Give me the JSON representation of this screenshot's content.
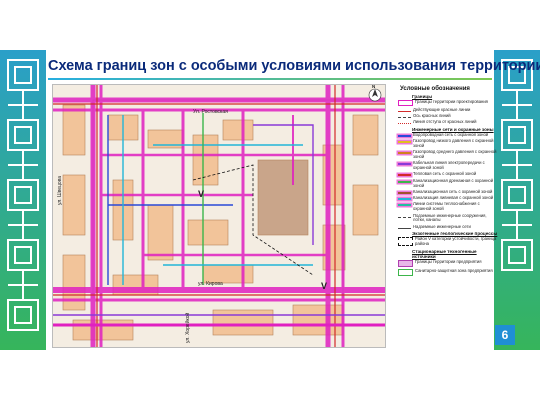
{
  "slide": {
    "title": "Схема границ зон с особыми условиями использования территории",
    "page_number": "6"
  },
  "colors": {
    "border_green": "#2bb673",
    "border_teal": "#1fa0c8",
    "title_blue": "#0a2a7a",
    "page_badge": "#1f8fd4",
    "zone_magenta": "#e020c0",
    "zone_red": "#d22a2a",
    "building": "#f2c49a"
  },
  "map": {
    "streets": {
      "top": "Ул. Ростовская",
      "left": "ул. Швецова",
      "bottom": "ул. Кирова",
      "bottom_left": "ул. Хорейкой"
    },
    "zone_markers": [
      "V",
      "V"
    ],
    "north_arrow_label": "N"
  },
  "legend": {
    "title": "Условные обозначения",
    "sections": [
      {
        "heading": "Границы",
        "items": [
          {
            "symbol": "boundary",
            "text": "Границы территории проектирования"
          },
          {
            "symbol": "red-line",
            "text": "Действующие красные линии"
          },
          {
            "symbol": "dash-line",
            "text": "Ось красных линий"
          },
          {
            "symbol": "thin-line",
            "text": "Линия отступа от красных линий"
          }
        ]
      },
      {
        "heading": "Инженерные сети и охранные зоны",
        "items": [
          {
            "symbol": "water",
            "text": "Водопроводная сеть с охранной зоной"
          },
          {
            "symbol": "gas-low",
            "text": "Газопровод низкого давления с охранной зоной"
          },
          {
            "symbol": "gas-mid",
            "text": "Газопровод среднего давления с охранной зоной"
          },
          {
            "symbol": "cable",
            "text": "Кабельная линия электропередачи с охранной зоной"
          },
          {
            "symbol": "heat",
            "text": "Тепловая сеть с охранной зоной"
          },
          {
            "symbol": "drain",
            "text": "Канализационная дренажная с охранной зоной"
          },
          {
            "symbol": "sewer",
            "text": "Канализационная сеть с охранной зоной"
          },
          {
            "symbol": "sewer2",
            "text": "Канализация ливневая с охранной зоной"
          },
          {
            "symbol": "heatline",
            "text": "Линии системы теплоснабжения с охранной зоной"
          },
          {
            "symbol": "underground",
            "text": "Подземные инженерные сооружения, лотки, каналы"
          },
          {
            "symbol": "aboveground",
            "text": "Надземные инженерные сети"
          }
        ]
      },
      {
        "heading": "Экзогенные геологические процессы",
        "items": [
          {
            "symbol": "zone-v",
            "text": "Район V категории устойчивости, граница района"
          }
        ]
      },
      {
        "heading": "Стационарные техногенные источники",
        "items": [
          {
            "symbol": "enterprise",
            "text": "Границы территории предприятия"
          },
          {
            "symbol": "sanitary",
            "text": "Санитарно-защитная зона предприятия"
          }
        ]
      }
    ]
  }
}
